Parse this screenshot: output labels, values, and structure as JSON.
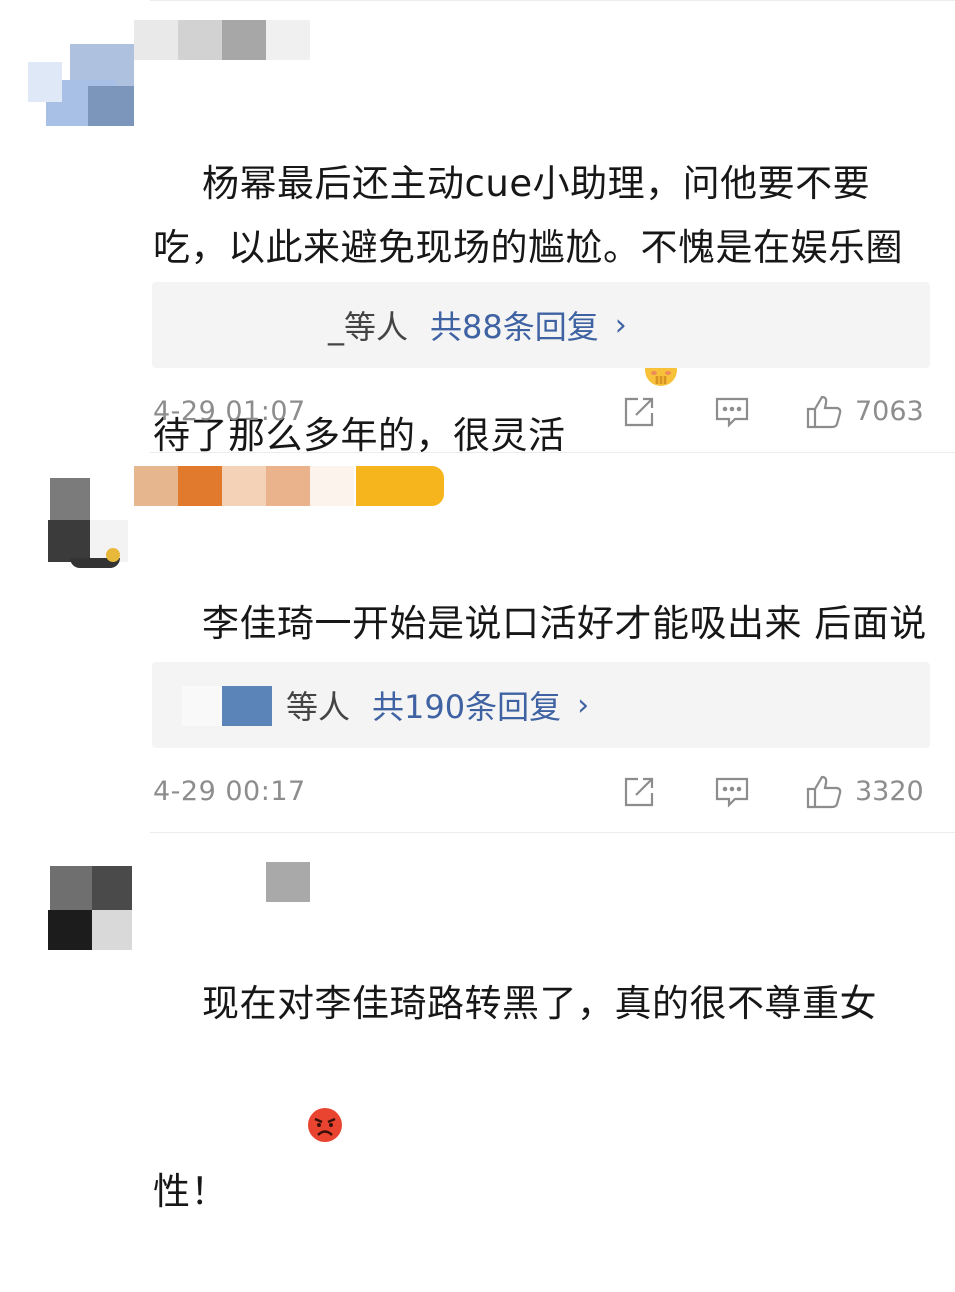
{
  "comments": [
    {
      "text": "杨幂最后还主动cue小助理，问他要不要吃，以此来避免现场的尴尬。不愧是在娱乐圈待了那么多年的，很灵活",
      "emoji": "hand-over-mouth-emoji",
      "replies_prefix": "_等人",
      "replies_count_label": "共88条回复",
      "chevron": "›",
      "time": "4-29 01:07",
      "likes": "7063"
    },
    {
      "text": "李佳琦一开始是说口活好才能吸出来 后面说可以开黄腔吗？可能无心的吧",
      "replies_prefix": "等人",
      "replies_count_label": "共190条回复",
      "chevron": "›",
      "time": "4-29 00:17",
      "likes": "3320"
    },
    {
      "text": "现在对李佳琦路转黑了，真的很不尊重女性！",
      "emoji": "angry-face-emoji"
    }
  ],
  "icons": {
    "share": "share-icon",
    "comment": "comment-icon",
    "like": "thumbs-up-icon"
  },
  "colors": {
    "reply_link": "#3f62a3",
    "meta_gray": "#8d8d8d",
    "reply_bg": "#f4f4f4"
  }
}
